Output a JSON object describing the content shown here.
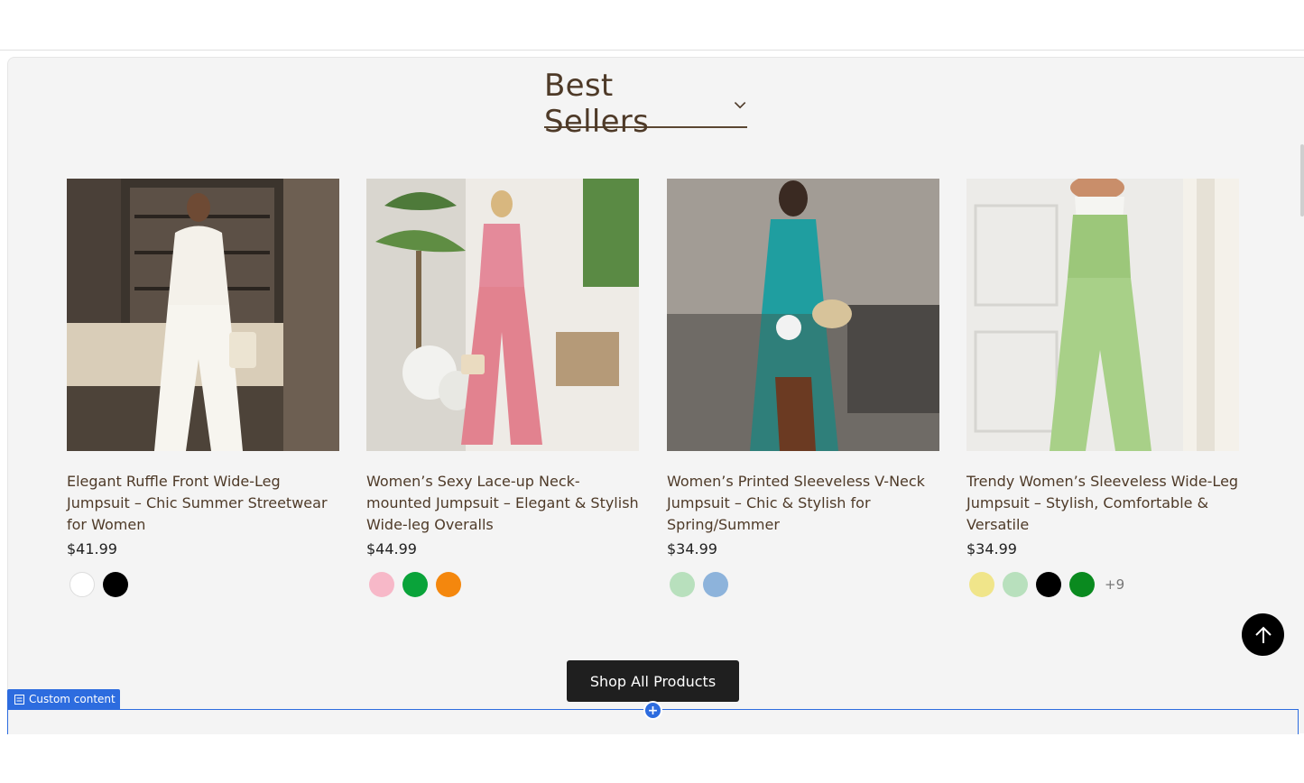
{
  "section": {
    "heading": "Best Sellers",
    "shop_all_label": "Shop All Products",
    "custom_tag_label": "Custom content"
  },
  "products": [
    {
      "title": "Elegant Ruffle Front Wide-Leg Jumpsuit – Chic Summer Streetwear for Women",
      "price": "$41.99",
      "swatches": [
        "#ffffff",
        "#000000"
      ],
      "more": ""
    },
    {
      "title": "Women’s Sexy Lace-up Neck-mounted Jumpsuit – Elegant & Stylish Wide-leg Overalls",
      "price": "$44.99",
      "swatches": [
        "#f7b8c8",
        "#0aa33a",
        "#f4870d"
      ],
      "more": ""
    },
    {
      "title": "Women’s Printed Sleeveless V-Neck Jumpsuit – Chic & Stylish for Spring/Summer",
      "price": "$34.99",
      "swatches": [
        "#b8e0bd",
        "#8db3db"
      ],
      "more": ""
    },
    {
      "title": "Trendy Women’s Sleeveless Wide-Leg Jumpsuit – Stylish, Comfortable & Versatile",
      "price": "$34.99",
      "swatches": [
        "#f0e58a",
        "#b8e0bd",
        "#000000",
        "#0a8a1f"
      ],
      "more": "+9"
    }
  ],
  "colors": {
    "heading_brown": "#4e3a28",
    "accent_blue": "#2d6cdf",
    "button_dark": "#1f1f1f"
  }
}
